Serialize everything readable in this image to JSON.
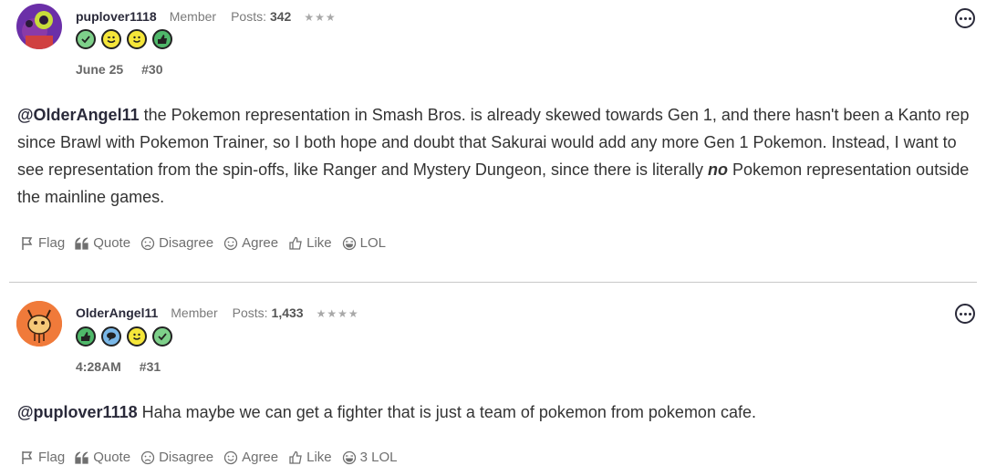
{
  "posts": [
    {
      "username": "puplover1118",
      "role": "Member",
      "posts_label": "Posts:",
      "posts_count": "342",
      "stars": "★★★",
      "badges": [
        "checkmark",
        "wink",
        "smile",
        "thumbs-up"
      ],
      "date": "June 25",
      "post_number": "#30",
      "mention": "@OlderAngel11",
      "text_before_em": " the Pokemon representation in Smash Bros. is already skewed towards Gen 1, and there hasn't been a Kanto rep since Brawl with Pokemon Trainer, so I both hope and doubt that Sakurai would add any more Gen 1 Pokemon. Instead, I want to see representation from the spin-offs, like Ranger and Mystery Dungeon, since there is literally ",
      "em_text": "no",
      "text_after_em": " Pokemon representation outside the mainline games.",
      "actions": {
        "flag": "Flag",
        "quote": "Quote",
        "disagree": "Disagree",
        "agree": "Agree",
        "like": "Like",
        "lol": "LOL"
      }
    },
    {
      "username": "OlderAngel11",
      "role": "Member",
      "posts_label": "Posts:",
      "posts_count": "1,433",
      "stars": "★★★★",
      "badges": [
        "thumbs-up",
        "speech-bubble",
        "smile",
        "checkmark"
      ],
      "date": "4:28AM",
      "post_number": "#31",
      "mention": "@puplover1118",
      "text": " Haha maybe we can get a fighter that is just a team of pokemon from pokemon cafe.",
      "actions": {
        "flag": "Flag",
        "quote": "Quote",
        "disagree": "Disagree",
        "agree": "Agree",
        "like": "Like",
        "lol": "3 LOL"
      }
    }
  ],
  "colors": {
    "check": "#7ed08a",
    "wink": "#f5e63a",
    "smile": "#f5e63a",
    "thumbs": "#4fb86a",
    "bubble": "#7ab8e8"
  }
}
